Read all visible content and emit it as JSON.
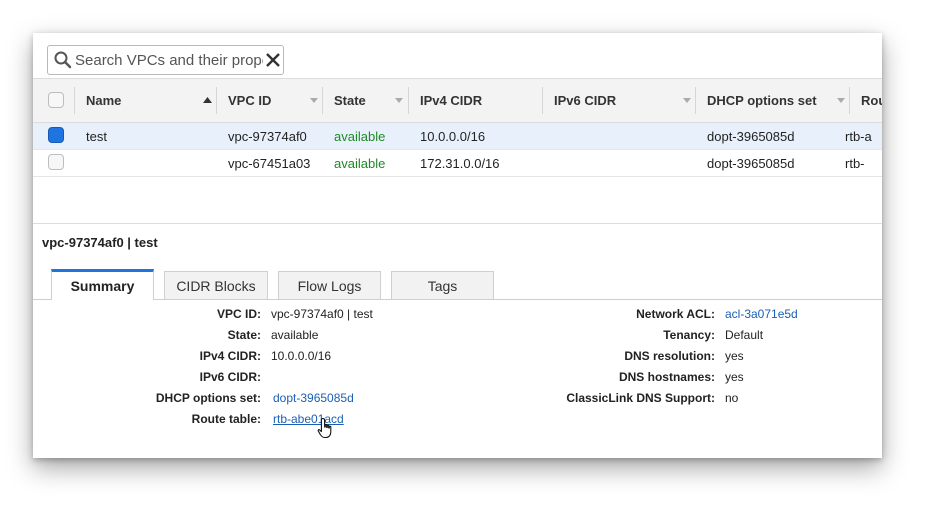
{
  "search": {
    "text": "Search VPCs and their proper"
  },
  "table": {
    "headers": {
      "name": "Name",
      "vpc_id": "VPC ID",
      "state": "State",
      "ipv4": "IPv4 CIDR",
      "ipv6": "IPv6 CIDR",
      "dhcp": "DHCP options set",
      "route": "Rou"
    },
    "rows": [
      {
        "checked": true,
        "name": "test",
        "vpc_id": "vpc-97374af0",
        "state": "available",
        "ipv4": "10.0.0.0/16",
        "ipv6": "",
        "dhcp": "dopt-3965085d",
        "route": "rtb-a"
      },
      {
        "checked": false,
        "name": "",
        "vpc_id": "vpc-67451a03",
        "state": "available",
        "ipv4": "172.31.0.0/16",
        "ipv6": "",
        "dhcp": "dopt-3965085d",
        "route": "rtb-"
      }
    ]
  },
  "detail": {
    "title": "vpc-97374af0 | test",
    "tabs": [
      "Summary",
      "CIDR Blocks",
      "Flow Logs",
      "Tags"
    ],
    "active_tab": "Summary",
    "left": [
      {
        "label": "VPC ID:",
        "value": "vpc-97374af0 | test"
      },
      {
        "label": "State:",
        "value": "available"
      },
      {
        "label": "IPv4 CIDR:",
        "value": "10.0.0.0/16"
      },
      {
        "label": "IPv6 CIDR:",
        "value": ""
      },
      {
        "label": "DHCP options set:",
        "value": "dopt-3965085d"
      },
      {
        "label": "Route table:",
        "value": "rtb-abe01acd"
      }
    ],
    "right": [
      {
        "label": "Network ACL:",
        "value": "acl-3a071e5d"
      },
      {
        "label": "Tenancy:",
        "value": "Default"
      },
      {
        "label": "DNS resolution:",
        "value": "yes"
      },
      {
        "label": "DNS hostnames:",
        "value": "yes"
      },
      {
        "label": "ClassicLink DNS Support:",
        "value": "no"
      }
    ]
  },
  "colors": {
    "accent": "#1f74e0",
    "link": "#1a5fb4",
    "available": "#1d8a25",
    "selected_row": "#e8f1fb"
  }
}
